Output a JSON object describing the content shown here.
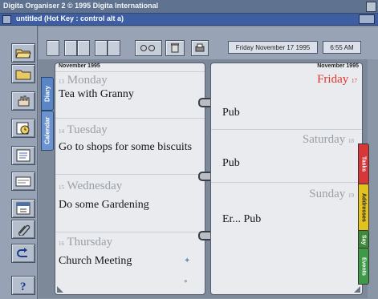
{
  "window": {
    "title": "Digita Organiser 2 © 1995 Digita International",
    "document_title": "untitled (Hot Key : control alt a)"
  },
  "toolbar": {
    "date_display": "Friday November 17 1995",
    "time_display": "6:55 AM"
  },
  "left_tabs": [
    "Diary",
    "Calendar"
  ],
  "right_tabs": [
    {
      "label": "Tasks",
      "color": "#d8373a"
    },
    {
      "label": "Addresses",
      "color": "#e2c21f"
    },
    {
      "label": "Say",
      "color": "#3f8a3a"
    },
    {
      "label": "Events",
      "color": "#3f9a48"
    }
  ],
  "left_page": {
    "month_header": "November 1995",
    "days": [
      {
        "num": "13",
        "name": "Monday",
        "entry": "Tea with Granny"
      },
      {
        "num": "14",
        "name": "Tuesday",
        "entry": "Go to shops for some biscuits"
      },
      {
        "num": "15",
        "name": "Wednesday",
        "entry": "Do some Gardening"
      },
      {
        "num": "16",
        "name": "Thursday",
        "entry": "Church Meeting"
      }
    ]
  },
  "right_page": {
    "month_header": "November 1995",
    "days": [
      {
        "num": "17",
        "name": "Friday",
        "entry": "Pub",
        "color": "#e0342e"
      },
      {
        "num": "18",
        "name": "Saturday",
        "entry": "Pub",
        "color": "#9aa0a8"
      },
      {
        "num": "19",
        "name": "Sunday",
        "entry": "Er... Pub",
        "color": "#9aa0a8"
      }
    ]
  },
  "sidebar_icons": [
    "open-folder-icon",
    "folder-icon",
    "hand-icon",
    "clock-icon",
    "list-icon",
    "card-icon",
    "calendar-icon",
    "paperclip-icon",
    "undo-icon",
    "help-icon"
  ],
  "colors": {
    "accent": "#3d5ea3",
    "today": "#e0342e"
  }
}
